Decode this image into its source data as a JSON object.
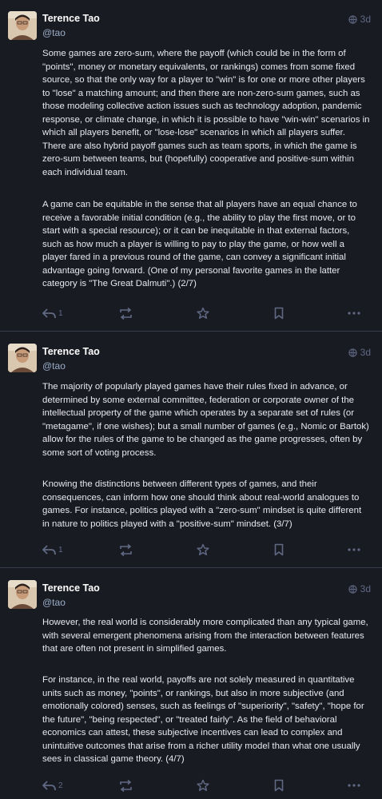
{
  "posts": [
    {
      "author": "Terence Tao",
      "handle": "@tao",
      "visibility_icon": "globe-icon",
      "time": "3d",
      "paragraphs": [
        "Some games are zero-sum, where the payoff (which could be in the form of \"points\", money or monetary equivalents, or rankings) comes from some fixed source, so that the only way for a player to \"win\" is for one or more other players to \"lose\" a matching amount; and then there are non-zero-sum games, such as those modeling collective action issues such as technology adoption, pandemic response, or climate change, in which it is possible to have \"win-win\" scenarios in which all players benefit, or \"lose-lose\" scenarios in which all players suffer. There are also hybrid payoff games such as team sports, in which the game is zero-sum between teams, but (hopefully) cooperative and positive-sum within each individual team.",
        "A game can be equitable in the sense that all players have an equal chance to receive a favorable initial condition (e.g., the ability to play the first move, or to start with a special resource); or it can be inequitable in that external factors, such as how much a player is willing to pay to play the game, or how well a player fared in a previous round of the game, can convey a significant initial advantage going forward.  (One of my personal favorite games in the latter category is \"The Great Dalmuti\".) (2/7)"
      ],
      "reply_count": "1"
    },
    {
      "author": "Terence Tao",
      "handle": "@tao",
      "visibility_icon": "globe-icon",
      "time": "3d",
      "paragraphs": [
        "The majority of popularly played games have their rules fixed in advance, or determined by some external committee, federation or corporate owner of the intellectual property of the game which operates by a separate set of rules (or \"metagame\", if one wishes); but a small number of games (e.g., Nomic or Bartok) allow for the rules of the game to be changed as the game progresses, often by some sort of voting process.",
        "Knowing the distinctions between different types of games, and their consequences, can inform how one should think about real-world analogues to games.  For instance, politics played with a \"zero-sum\" mindset is quite different in nature to politics played with a \"positive-sum\" mindset. (3/7)"
      ],
      "reply_count": "1"
    },
    {
      "author": "Terence Tao",
      "handle": "@tao",
      "visibility_icon": "globe-icon",
      "time": "3d",
      "paragraphs": [
        "However, the real world is considerably more complicated than any typical game, with several emergent phenomena arising from the interaction between features that are often not present in simplified games.",
        "For instance, in the real world, payoffs are not solely measured in quantitative units such as money, \"points\", or rankings, but also in more subjective (and emotionally colored) senses, such as feelings of \"superiority\", \"safety\", \"hope for the future\", \"being respected\", or \"treated fairly\".  As the field of behavioral economics can attest, these subjective incentives can lead to complex and unintuitive outcomes that arise from a richer utility model than what one usually sees in classical game theory. (4/7)"
      ],
      "reply_count": "2"
    }
  ],
  "action_icons": [
    "reply-icon",
    "boost-icon",
    "favourite-icon",
    "bookmark-icon",
    "more-icon"
  ],
  "colors": {
    "background": "#191b22",
    "text": "#e8e8ef",
    "muted": "#606984",
    "handle": "#9baec8",
    "divider": "#393f4f"
  }
}
